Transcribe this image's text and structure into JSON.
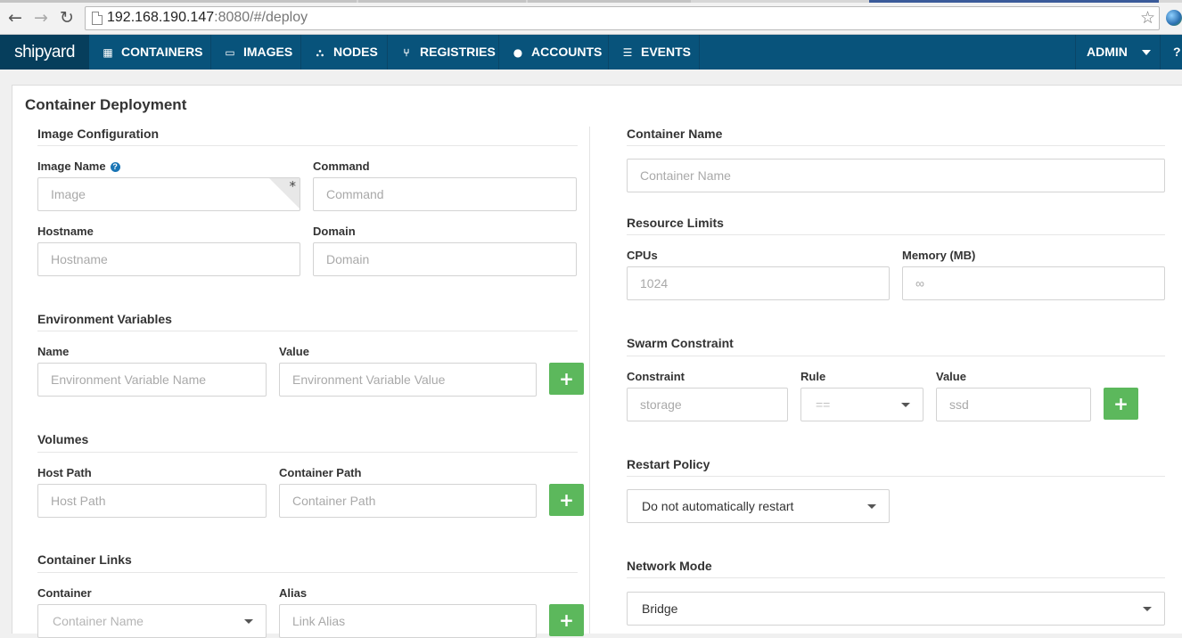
{
  "browser": {
    "url_host": "192.168.190.147",
    "url_rest": ":8080/#/deploy"
  },
  "navbar": {
    "brand": "shipyard",
    "items": [
      {
        "label": "CONTAINERS",
        "icon": "grid-icon"
      },
      {
        "label": "IMAGES",
        "icon": "hdd-icon"
      },
      {
        "label": "NODES",
        "icon": "sitemap-icon"
      },
      {
        "label": "REGISTRIES",
        "icon": "branch-icon"
      },
      {
        "label": "ACCOUNTS",
        "icon": "user-icon"
      },
      {
        "label": "EVENTS",
        "icon": "list-icon"
      }
    ],
    "admin": "ADMIN",
    "help": "?"
  },
  "page": {
    "title": "Container Deployment"
  },
  "image_config": {
    "heading": "Image Configuration",
    "image_name_label": "Image Name",
    "image_placeholder": "Image",
    "command_label": "Command",
    "command_placeholder": "Command",
    "hostname_label": "Hostname",
    "hostname_placeholder": "Hostname",
    "domain_label": "Domain",
    "domain_placeholder": "Domain"
  },
  "env_vars": {
    "heading": "Environment Variables",
    "name_label": "Name",
    "name_placeholder": "Environment Variable Name",
    "value_label": "Value",
    "value_placeholder": "Environment Variable Value",
    "add": "+"
  },
  "volumes": {
    "heading": "Volumes",
    "host_label": "Host Path",
    "host_placeholder": "Host Path",
    "container_label": "Container Path",
    "container_placeholder": "Container Path",
    "add": "+"
  },
  "links": {
    "heading": "Container Links",
    "container_label": "Container",
    "container_placeholder": "Container Name",
    "alias_label": "Alias",
    "alias_placeholder": "Link Alias",
    "add": "+"
  },
  "container_name": {
    "heading": "Container Name",
    "placeholder": "Container Name"
  },
  "resources": {
    "heading": "Resource Limits",
    "cpus_label": "CPUs",
    "cpus_placeholder": "1024",
    "memory_label": "Memory (MB)",
    "memory_placeholder": "∞"
  },
  "swarm": {
    "heading": "Swarm Constraint",
    "constraint_label": "Constraint",
    "constraint_placeholder": "storage",
    "rule_label": "Rule",
    "rule_value": "==",
    "value_label": "Value",
    "value_placeholder": "ssd",
    "add": "+"
  },
  "restart": {
    "heading": "Restart Policy",
    "value": "Do not automatically restart"
  },
  "network": {
    "heading": "Network Mode",
    "value": "Bridge"
  },
  "colors": {
    "navbar": "#08537b",
    "brand_bg": "#063e5c",
    "add_button": "#5cb85c",
    "help_icon": "#1a75b5"
  }
}
